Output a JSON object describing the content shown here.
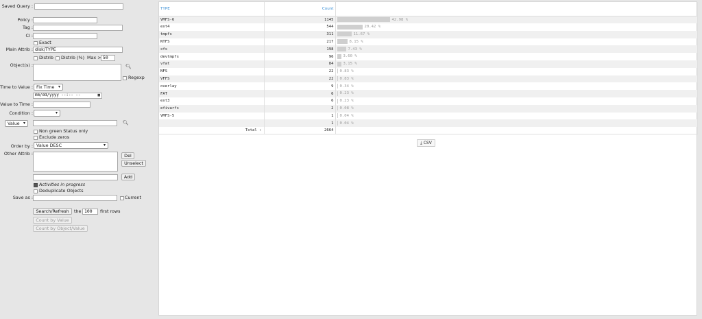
{
  "form": {
    "saved_query_label": "Saved Query :",
    "saved_query_value": "",
    "policy_label": "Policy :",
    "policy_value": "",
    "tag_label": "Tag :",
    "tag_value": "",
    "ci_label": "CI :",
    "ci_value": "",
    "exact_label": "Exact",
    "main_attrib_label": "Main Attrib :",
    "main_attrib_value": "disk/TYPE",
    "distrib_label": "Distrib",
    "distrib_pct_label": "Distrib (%)",
    "max_label": "Max >",
    "max_value": "50",
    "objects_label": "Object(s) :",
    "regexp_label": "Regexp",
    "time_to_value_label": "Time to Value :",
    "time_to_value_select": "Fix Time",
    "datetime_placeholder": "mm/dd/yyyy  --:-- --",
    "value_to_time_label": "Value to Time :",
    "condition_label": "Condition :",
    "condition_select": "",
    "value_select": "Value",
    "non_green_label": "Non green Status only",
    "exclude_zeros_label": "Exclude zeros",
    "order_by_label": "Order by :",
    "order_by_select": "Value DESC",
    "other_attrib_label": "Other Attrib :",
    "del_label": "Del",
    "unselect_label": "Unselect",
    "add_label": "Add",
    "activities_label": "Activities in progress",
    "dedup_label": "Deduplicate Objects",
    "save_as_label": "Save as :",
    "current_label": "Current",
    "search_refresh_label": "Search/Refresh",
    "the_label": "the",
    "rows_value": "100",
    "first_rows_label": "first rows",
    "count_by_value_label": "Count by Value",
    "count_by_object_value_label": "Count by Object/Value"
  },
  "results": {
    "col_type": "TYPE",
    "col_count": "Count",
    "rows": [
      {
        "type": "VMFS-6",
        "count": "1145",
        "pct": "42.98 %",
        "fraction": 0.4298
      },
      {
        "type": "ext4",
        "count": "544",
        "pct": "20.42 %",
        "fraction": 0.2042
      },
      {
        "type": "tmpfs",
        "count": "311",
        "pct": "11.67 %",
        "fraction": 0.1167
      },
      {
        "type": "NTFS",
        "count": "217",
        "pct": "8.15 %",
        "fraction": 0.0815
      },
      {
        "type": "xfs",
        "count": "198",
        "pct": "7.43 %",
        "fraction": 0.0743
      },
      {
        "type": "devtmpfs",
        "count": "96",
        "pct": "3.60 %",
        "fraction": 0.036
      },
      {
        "type": "vfat",
        "count": "84",
        "pct": "3.15 %",
        "fraction": 0.0315
      },
      {
        "type": "NFS",
        "count": "22",
        "pct": "0.83 %",
        "fraction": 0.0083
      },
      {
        "type": "VFFS",
        "count": "22",
        "pct": "0.83 %",
        "fraction": 0.0083
      },
      {
        "type": "overlay",
        "count": "9",
        "pct": "0.34 %",
        "fraction": 0.0034
      },
      {
        "type": "FAT",
        "count": "6",
        "pct": "0.23 %",
        "fraction": 0.0023
      },
      {
        "type": "ext3",
        "count": "6",
        "pct": "0.23 %",
        "fraction": 0.0023
      },
      {
        "type": "efivarfs",
        "count": "2",
        "pct": "0.08 %",
        "fraction": 0.0008
      },
      {
        "type": "VMFS-5",
        "count": "1",
        "pct": "0.04 %",
        "fraction": 0.0004
      },
      {
        "type": "",
        "count": "1",
        "pct": "0.04 %",
        "fraction": 0.0004
      }
    ],
    "total_label": "Total :",
    "total_value": "2664",
    "csv_label": "CSV"
  }
}
